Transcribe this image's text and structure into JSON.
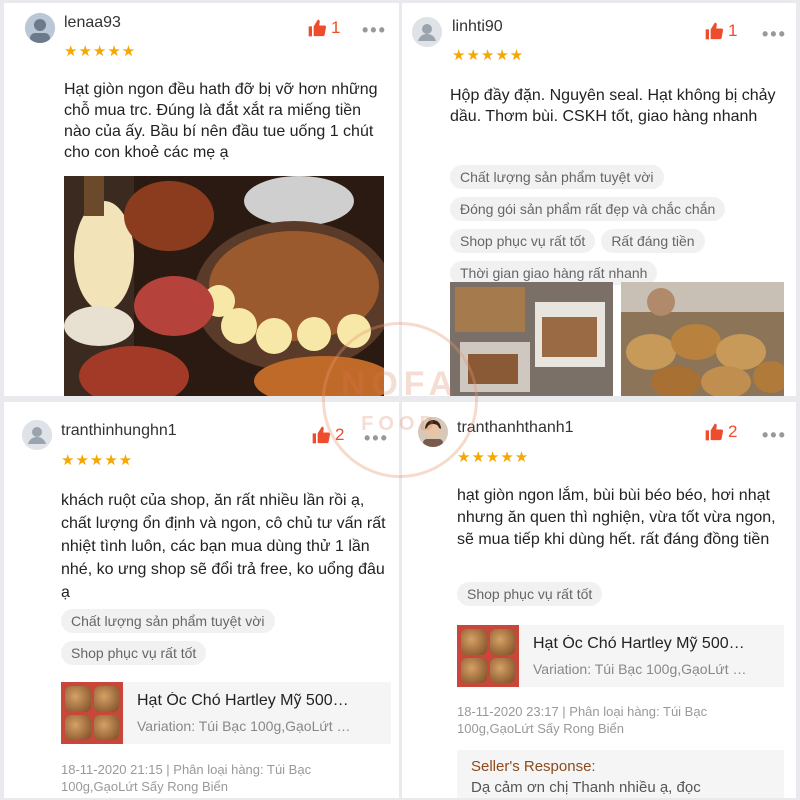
{
  "colors": {
    "accent": "#ee4d2d",
    "star": "#f6a700",
    "tag_bg": "#f1f1f1",
    "seller_title": "#8c4a1c"
  },
  "watermark": {
    "line1": "NOFA",
    "line2": "FOOD"
  },
  "reviews": [
    {
      "username": "lenaa93",
      "stars": "★★★★★",
      "likes": "1",
      "more": "•••",
      "text": "Hạt giòn ngon đều hath đỡ bị vỡ hơn những chỗ mua trc. Đúng là đắt xắt ra miếng tiền nào của ấy. Bầu bí nên đầu tue uống 1 chút cho con khoẻ các mẹ ạ",
      "photo_icon": "bbq-food-photo"
    },
    {
      "username": "linhti90",
      "stars": "★★★★★",
      "likes": "1",
      "more": "•••",
      "text": "Hộp đầy đặn. Nguyên seal. Hạt không bị chảy dầu. Thơm bùi. CSKH tốt, giao hàng nhanh",
      "tags": [
        "Chất lượng sản phẩm tuyệt vời",
        "Đóng gói sản phẩm rất đẹp và chắc chắn",
        "Shop phục vụ rất tốt",
        "Rất đáng tiền",
        "Thời gian giao hàng rất nhanh"
      ]
    },
    {
      "username": "tranthinhunghn1",
      "stars": "★★★★★",
      "likes": "2",
      "more": "•••",
      "text": "khách ruột của shop, ăn rất nhiều lần rồi ạ, chất lượng ổn định và ngon, cô chủ tư vấn rất nhiệt tình luôn, các bạn mua dùng thử 1 lần nhé, ko ưng shop sẽ đổi trả free, ko uổng đâu ạ",
      "tags": [
        "Chất lượng sản phẩm tuyệt vời",
        "Shop phục vụ rất tốt"
      ],
      "product_name": "Hạt Óc Chó Hartley Mỹ 500…",
      "product_variation": "Variation: Túi Bạc 100g,GạoLứt …",
      "meta": "18-11-2020 21:15 | Phân loại hàng: Túi Bạc 100g,GạoLứt Sấy Rong Biển"
    },
    {
      "username": "tranthanhthanh1",
      "stars": "★★★★★",
      "likes": "2",
      "more": "•••",
      "text": "hạt giòn ngon lắm, bùi bùi béo béo, hơi nhạt nhưng ăn quen thì nghiện, vừa tốt vừa ngon, sẽ mua tiếp khi dùng hết. rất đáng đồng tiền",
      "tags": [
        "Shop phục vụ rất tốt"
      ],
      "product_name": "Hạt Óc Chó Hartley Mỹ 500…",
      "product_variation": "Variation: Túi Bạc 100g,GạoLứt …",
      "meta": "18-11-2020 23:17 | Phân loại hàng: Túi Bạc 100g,GạoLứt Sấy Rong Biển",
      "seller_response_title": "Seller's Response:",
      "seller_response_text": "Dạ cảm ơn chị Thanh nhiều ạ, đọc"
    }
  ]
}
